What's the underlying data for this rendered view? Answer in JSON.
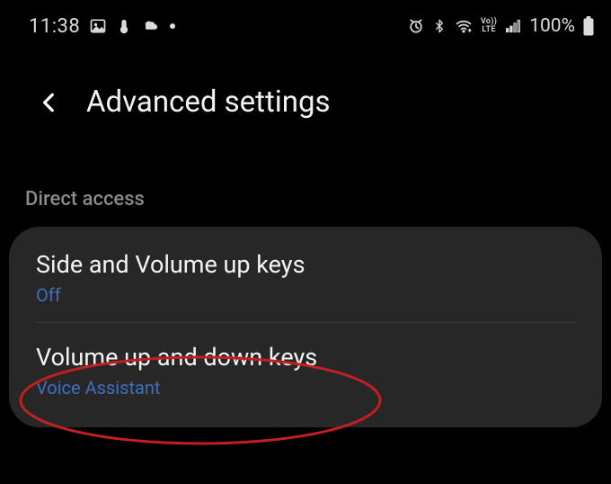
{
  "status": {
    "time": "11:38",
    "battery_text": "100%"
  },
  "header": {
    "title": "Advanced settings"
  },
  "section": {
    "label": "Direct access"
  },
  "rows": {
    "side_volume": {
      "title": "Side and Volume up keys",
      "sub": "Off"
    },
    "volume_updown": {
      "title": "Volume up and down keys",
      "sub": "Voice Assistant"
    }
  }
}
